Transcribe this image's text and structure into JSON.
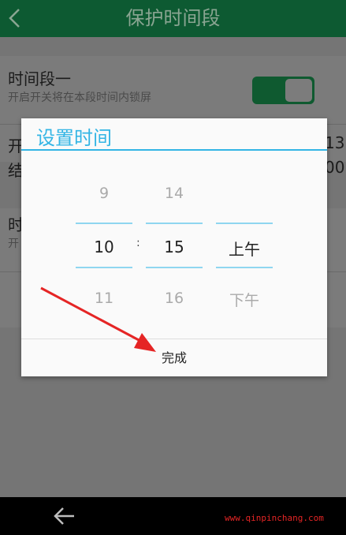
{
  "header": {
    "title": "保护时间段",
    "back_icon": "chevron-left-icon"
  },
  "section1": {
    "title": "时间段一",
    "subtitle": "开启开关将在本段时间内锁屏",
    "toggle_on": true,
    "start_label_peek": "开",
    "end_label_peek": "结",
    "start_value_peek": "13",
    "end_value_peek": "00"
  },
  "section2": {
    "title_peek": "时",
    "subtitle_peek": "开"
  },
  "dialog": {
    "title": "设置时间",
    "hour": {
      "prev": "9",
      "selected": "10",
      "next": "11"
    },
    "separator": ":",
    "minute": {
      "prev": "14",
      "selected": "15",
      "next": "16"
    },
    "ampm": {
      "selected": "上午",
      "next": "下午"
    },
    "done_label": "完成"
  },
  "navbar": {
    "back_icon": "back-arrow-icon",
    "watermark": "www.qinpinchang.com"
  },
  "colors": {
    "accent": "#33b5e5",
    "toolbar": "#0d5a32",
    "arrow": "#e52525"
  }
}
